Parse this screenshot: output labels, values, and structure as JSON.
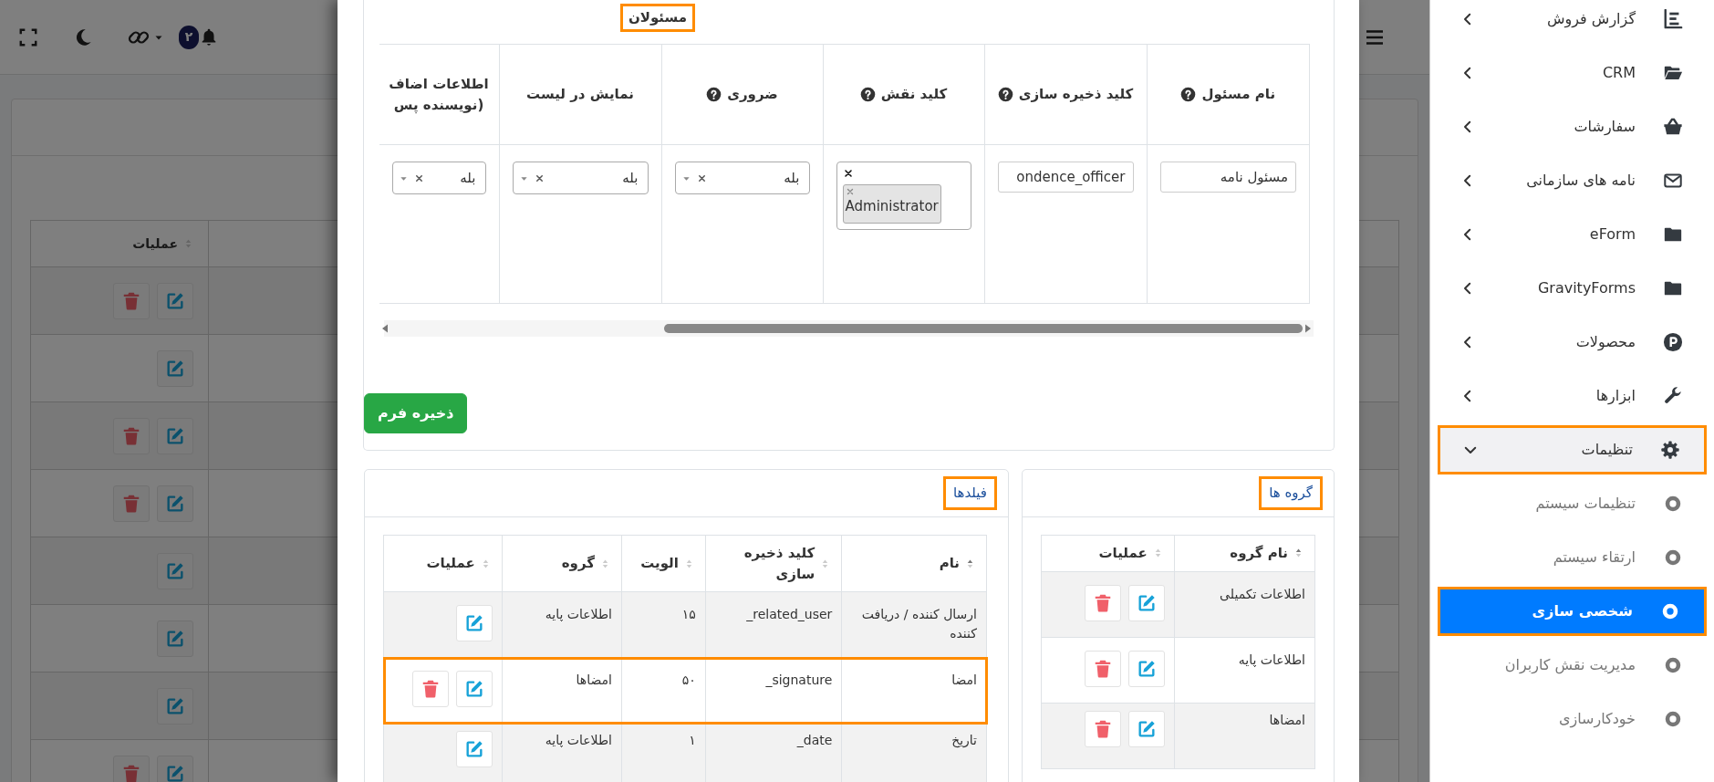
{
  "topbar": {
    "notification_count": "۲"
  },
  "list_table": {
    "columns": [
      "عملیات"
    ],
    "rows": [
      {
        "can_delete": true
      },
      {
        "can_delete": false
      },
      {
        "can_delete": true
      },
      {
        "can_delete": true
      },
      {
        "can_delete": false
      },
      {
        "can_delete": false
      },
      {
        "can_delete": false
      },
      {
        "can_delete": true
      }
    ]
  },
  "modal": {
    "officers": {
      "title": "مسئولان",
      "highlighted": true,
      "columns": [
        {
          "label": "نام مسئول",
          "help": true
        },
        {
          "label": "کلید ذخیره سازی",
          "help": true
        },
        {
          "label": "کلید نقش",
          "help": true
        },
        {
          "label": "ضروری",
          "help": true
        },
        {
          "label": "نمایش در لیست",
          "help": false
        },
        {
          "label": "اطلاعات اضاف (نویسنده پس",
          "help": false
        }
      ],
      "row": [
        {
          "kind": "text",
          "value": "مسئول نامه"
        },
        {
          "kind": "text",
          "value": "ondence_officer"
        },
        {
          "kind": "tags",
          "tags": [
            "Administrator"
          ]
        },
        {
          "kind": "select",
          "value": "بله"
        },
        {
          "kind": "select",
          "value": "بله"
        },
        {
          "kind": "select",
          "value": "بله"
        }
      ],
      "save_button": "ذخیره فرم"
    },
    "groups": {
      "tab": "گروه ها",
      "highlighted": true,
      "columns": [
        {
          "label": "نام گروه",
          "sorted": true
        },
        {
          "label": "عملیات",
          "sorted": false
        }
      ],
      "rows": [
        {
          "name": "اطلاعات تکمیلی",
          "can_delete": true
        },
        {
          "name": "اطلاعات پایه",
          "can_delete": true
        },
        {
          "name": "امضاها",
          "can_delete": true
        }
      ]
    },
    "fields": {
      "tab": "فیلدها",
      "highlighted": true,
      "columns": [
        {
          "label": "نام",
          "sorted": true
        },
        {
          "label": "کلید ذخیره سازی",
          "sorted": false
        },
        {
          "label": "الویت",
          "sorted": false
        },
        {
          "label": "گروه",
          "sorted": false
        },
        {
          "label": "عملیات",
          "sorted": false
        }
      ],
      "rows": [
        {
          "cells": [
            "ارسال کننده / دریافت کننده",
            "related_user_",
            "۱۵",
            "اطلاعات پایه"
          ],
          "can_delete": false,
          "highlighted": false
        },
        {
          "cells": [
            "امضا",
            "signature_",
            "۵۰",
            "امضاها"
          ],
          "can_delete": true,
          "highlighted": true
        },
        {
          "cells": [
            "تاریخ",
            "date_",
            "۱",
            "اطلاعات پایه"
          ],
          "can_delete": false,
          "highlighted": false
        }
      ]
    }
  },
  "sidebar": {
    "items": [
      {
        "label": "گزارش فروش",
        "kind": "report",
        "expanded": false,
        "highlighted": false
      },
      {
        "label": "CRM",
        "kind": "folder-open",
        "expanded": false,
        "highlighted": false
      },
      {
        "label": "سفارشات",
        "kind": "basket",
        "expanded": false,
        "highlighted": false
      },
      {
        "label": "نامه های سازمانی",
        "kind": "envelope",
        "expanded": false,
        "highlighted": false
      },
      {
        "label": "eForm",
        "kind": "folder",
        "expanded": false,
        "highlighted": false
      },
      {
        "label": "GravityForms",
        "kind": "folder",
        "expanded": false,
        "highlighted": false
      },
      {
        "label": "محصولات",
        "kind": "product",
        "expanded": false,
        "highlighted": false
      },
      {
        "label": "ابزارها",
        "kind": "wrench",
        "expanded": false,
        "highlighted": false
      },
      {
        "label": "تنظیمات",
        "kind": "gear",
        "expanded": true,
        "highlighted": true,
        "children": [
          {
            "label": "تنظیمات سیستم",
            "selected": false,
            "highlighted": false
          },
          {
            "label": "ارتقاء سیستم",
            "selected": false,
            "highlighted": false
          },
          {
            "label": "شخصی سازی",
            "selected": true,
            "highlighted": true
          },
          {
            "label": "مدیریت نقش کاربران",
            "selected": false,
            "highlighted": false
          },
          {
            "label": "خودکارسازی",
            "selected": false,
            "highlighted": false
          }
        ]
      }
    ]
  }
}
